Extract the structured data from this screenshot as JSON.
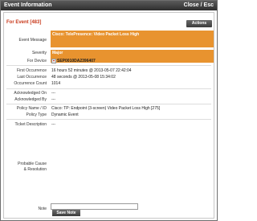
{
  "window": {
    "title": "Event Information",
    "close_label": "Close / Esc"
  },
  "header": {
    "event_heading": "For Event [483]",
    "actions_label": "Actions"
  },
  "fields": {
    "event_message_label": "Event Message",
    "event_message_value": "Cisco: TelePresence: Video Packet Loss High",
    "severity_label": "Severity",
    "severity_value": "Major",
    "for_device_label": "For Device",
    "for_device_value": "SEP0010DA2396407",
    "first_occurrence_label": "First Occurrence",
    "first_occurrence_value": "16 hours 52 minutes @ 2013-05-07 22:42:04",
    "last_occurrence_label": "Last Occurrence",
    "last_occurrence_value": "48 seconds @ 2013-05-08 15:34:02",
    "occurrence_count_label": "Occurrence Count",
    "occurrence_count_value": "1014",
    "acknowledged_on_label": "Acknowledged On",
    "acknowledged_on_value": "---",
    "acknowledged_by_label": "Acknowledged By",
    "acknowledged_by_value": "---",
    "policy_name_label": "Policy Name / ID",
    "policy_name_value": "Cisco: TP: Endpoint (3-screen) Video Packet Loss High [275]",
    "policy_type_label": "Policy Type",
    "policy_type_value": "Dynamic Event",
    "ticket_description_label": "Ticket Description",
    "ticket_description_value": "---",
    "probable_cause_label_line1": "Probable Cause",
    "probable_cause_label_line2": "& Resolution",
    "note_label": "Note"
  },
  "buttons": {
    "save_note_label": "Save Note"
  },
  "colors": {
    "title_bar": "#3a3a3a",
    "accent_orange": "#e8932f",
    "heading_red": "#c8381a"
  }
}
